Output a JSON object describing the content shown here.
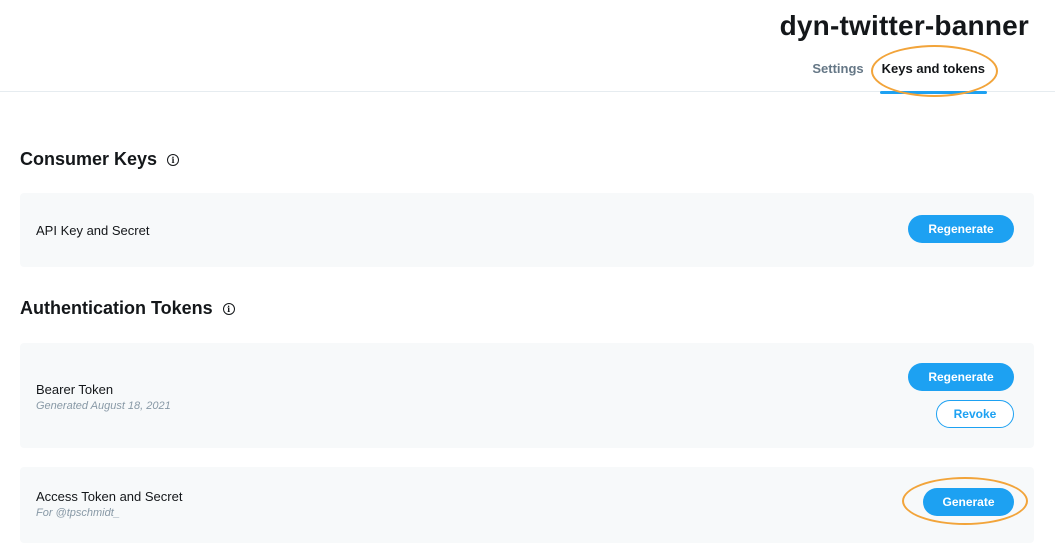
{
  "header": {
    "app_title": "dyn-twitter-banner",
    "tabs": [
      {
        "label": "Settings",
        "active": false
      },
      {
        "label": "Keys and tokens",
        "active": true
      }
    ]
  },
  "consumer_keys": {
    "title": "Consumer Keys",
    "info_icon": "info-icon",
    "api_key": {
      "label": "API Key and Secret",
      "button": "Regenerate"
    }
  },
  "auth_tokens": {
    "title": "Authentication Tokens",
    "info_icon": "info-icon",
    "bearer": {
      "label": "Bearer Token",
      "sub": "Generated August 18, 2021",
      "regenerate_button": "Regenerate",
      "revoke_button": "Revoke"
    },
    "access": {
      "label": "Access Token and Secret",
      "sub": "For @tpschmidt_",
      "generate_button": "Generate"
    }
  },
  "colors": {
    "accent": "#1da1f2",
    "highlight": "#f2a43a",
    "card_bg": "#f7f9fa"
  }
}
